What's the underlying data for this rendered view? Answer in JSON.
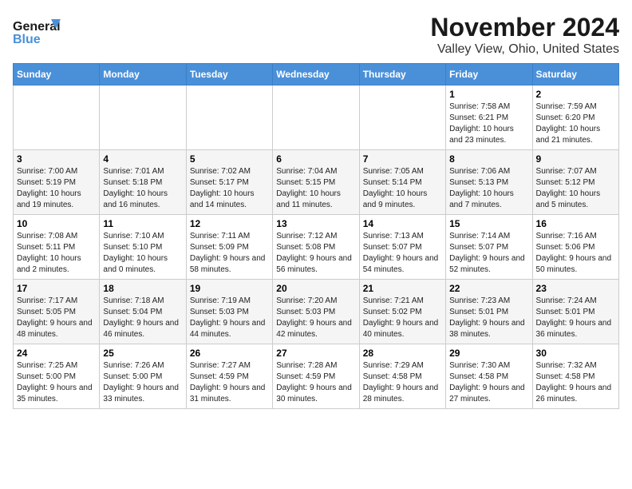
{
  "header": {
    "logo_line1": "General",
    "logo_line2": "Blue",
    "title": "November 2024",
    "subtitle": "Valley View, Ohio, United States"
  },
  "weekdays": [
    "Sunday",
    "Monday",
    "Tuesday",
    "Wednesday",
    "Thursday",
    "Friday",
    "Saturday"
  ],
  "weeks": [
    [
      {
        "day": "",
        "info": ""
      },
      {
        "day": "",
        "info": ""
      },
      {
        "day": "",
        "info": ""
      },
      {
        "day": "",
        "info": ""
      },
      {
        "day": "",
        "info": ""
      },
      {
        "day": "1",
        "info": "Sunrise: 7:58 AM\nSunset: 6:21 PM\nDaylight: 10 hours and 23 minutes."
      },
      {
        "day": "2",
        "info": "Sunrise: 7:59 AM\nSunset: 6:20 PM\nDaylight: 10 hours and 21 minutes."
      }
    ],
    [
      {
        "day": "3",
        "info": "Sunrise: 7:00 AM\nSunset: 5:19 PM\nDaylight: 10 hours and 19 minutes."
      },
      {
        "day": "4",
        "info": "Sunrise: 7:01 AM\nSunset: 5:18 PM\nDaylight: 10 hours and 16 minutes."
      },
      {
        "day": "5",
        "info": "Sunrise: 7:02 AM\nSunset: 5:17 PM\nDaylight: 10 hours and 14 minutes."
      },
      {
        "day": "6",
        "info": "Sunrise: 7:04 AM\nSunset: 5:15 PM\nDaylight: 10 hours and 11 minutes."
      },
      {
        "day": "7",
        "info": "Sunrise: 7:05 AM\nSunset: 5:14 PM\nDaylight: 10 hours and 9 minutes."
      },
      {
        "day": "8",
        "info": "Sunrise: 7:06 AM\nSunset: 5:13 PM\nDaylight: 10 hours and 7 minutes."
      },
      {
        "day": "9",
        "info": "Sunrise: 7:07 AM\nSunset: 5:12 PM\nDaylight: 10 hours and 5 minutes."
      }
    ],
    [
      {
        "day": "10",
        "info": "Sunrise: 7:08 AM\nSunset: 5:11 PM\nDaylight: 10 hours and 2 minutes."
      },
      {
        "day": "11",
        "info": "Sunrise: 7:10 AM\nSunset: 5:10 PM\nDaylight: 10 hours and 0 minutes."
      },
      {
        "day": "12",
        "info": "Sunrise: 7:11 AM\nSunset: 5:09 PM\nDaylight: 9 hours and 58 minutes."
      },
      {
        "day": "13",
        "info": "Sunrise: 7:12 AM\nSunset: 5:08 PM\nDaylight: 9 hours and 56 minutes."
      },
      {
        "day": "14",
        "info": "Sunrise: 7:13 AM\nSunset: 5:07 PM\nDaylight: 9 hours and 54 minutes."
      },
      {
        "day": "15",
        "info": "Sunrise: 7:14 AM\nSunset: 5:07 PM\nDaylight: 9 hours and 52 minutes."
      },
      {
        "day": "16",
        "info": "Sunrise: 7:16 AM\nSunset: 5:06 PM\nDaylight: 9 hours and 50 minutes."
      }
    ],
    [
      {
        "day": "17",
        "info": "Sunrise: 7:17 AM\nSunset: 5:05 PM\nDaylight: 9 hours and 48 minutes."
      },
      {
        "day": "18",
        "info": "Sunrise: 7:18 AM\nSunset: 5:04 PM\nDaylight: 9 hours and 46 minutes."
      },
      {
        "day": "19",
        "info": "Sunrise: 7:19 AM\nSunset: 5:03 PM\nDaylight: 9 hours and 44 minutes."
      },
      {
        "day": "20",
        "info": "Sunrise: 7:20 AM\nSunset: 5:03 PM\nDaylight: 9 hours and 42 minutes."
      },
      {
        "day": "21",
        "info": "Sunrise: 7:21 AM\nSunset: 5:02 PM\nDaylight: 9 hours and 40 minutes."
      },
      {
        "day": "22",
        "info": "Sunrise: 7:23 AM\nSunset: 5:01 PM\nDaylight: 9 hours and 38 minutes."
      },
      {
        "day": "23",
        "info": "Sunrise: 7:24 AM\nSunset: 5:01 PM\nDaylight: 9 hours and 36 minutes."
      }
    ],
    [
      {
        "day": "24",
        "info": "Sunrise: 7:25 AM\nSunset: 5:00 PM\nDaylight: 9 hours and 35 minutes."
      },
      {
        "day": "25",
        "info": "Sunrise: 7:26 AM\nSunset: 5:00 PM\nDaylight: 9 hours and 33 minutes."
      },
      {
        "day": "26",
        "info": "Sunrise: 7:27 AM\nSunset: 4:59 PM\nDaylight: 9 hours and 31 minutes."
      },
      {
        "day": "27",
        "info": "Sunrise: 7:28 AM\nSunset: 4:59 PM\nDaylight: 9 hours and 30 minutes."
      },
      {
        "day": "28",
        "info": "Sunrise: 7:29 AM\nSunset: 4:58 PM\nDaylight: 9 hours and 28 minutes."
      },
      {
        "day": "29",
        "info": "Sunrise: 7:30 AM\nSunset: 4:58 PM\nDaylight: 9 hours and 27 minutes."
      },
      {
        "day": "30",
        "info": "Sunrise: 7:32 AM\nSunset: 4:58 PM\nDaylight: 9 hours and 26 minutes."
      }
    ]
  ]
}
